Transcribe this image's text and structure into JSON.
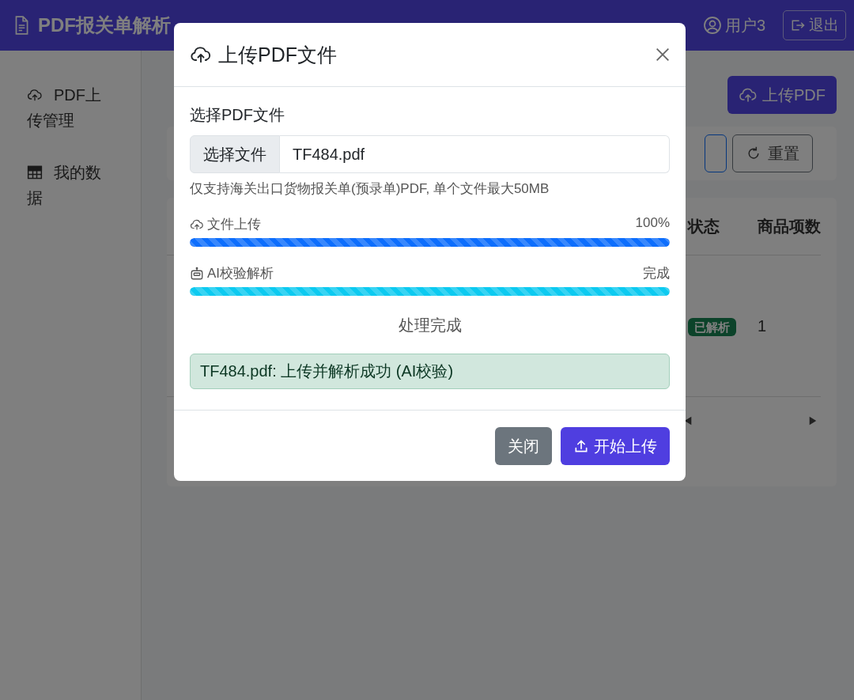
{
  "navbar": {
    "title": "PDF报关单解析",
    "user": "用户3",
    "logout": "退出"
  },
  "sidebar": {
    "items": [
      {
        "kind": "upload",
        "label": "PDF上传管理"
      },
      {
        "kind": "table",
        "label": "我的数据"
      }
    ]
  },
  "main": {
    "upload_button": "上传PDF",
    "reset_button": "重置",
    "table": {
      "columns": [
        {
          "label": "状态"
        },
        {
          "label": "商品项数"
        }
      ],
      "rows": [
        {
          "status": "已解析",
          "items": "1"
        }
      ]
    }
  },
  "modal": {
    "title": "上传PDF文件",
    "file_label": "选择PDF文件",
    "file_button": "选择文件",
    "file_name": "TF484.pdf",
    "hint": "仅支持海关出口货物报关单(预录单)PDF, 单个文件最大50MB",
    "progress": [
      {
        "kind": "upload",
        "label": "文件上传",
        "reading": "100%",
        "level": 1
      },
      {
        "kind": "ai",
        "label": "AI校验解析",
        "reading": "完成",
        "level": 1
      }
    ],
    "status": "处理完成",
    "alert": "TF484.pdf: 上传并解析成功 (AI校验)",
    "buttons": [
      {
        "kind": "secondary",
        "label": "关闭"
      },
      {
        "kind": "primary",
        "label": "开始上传"
      }
    ]
  }
}
